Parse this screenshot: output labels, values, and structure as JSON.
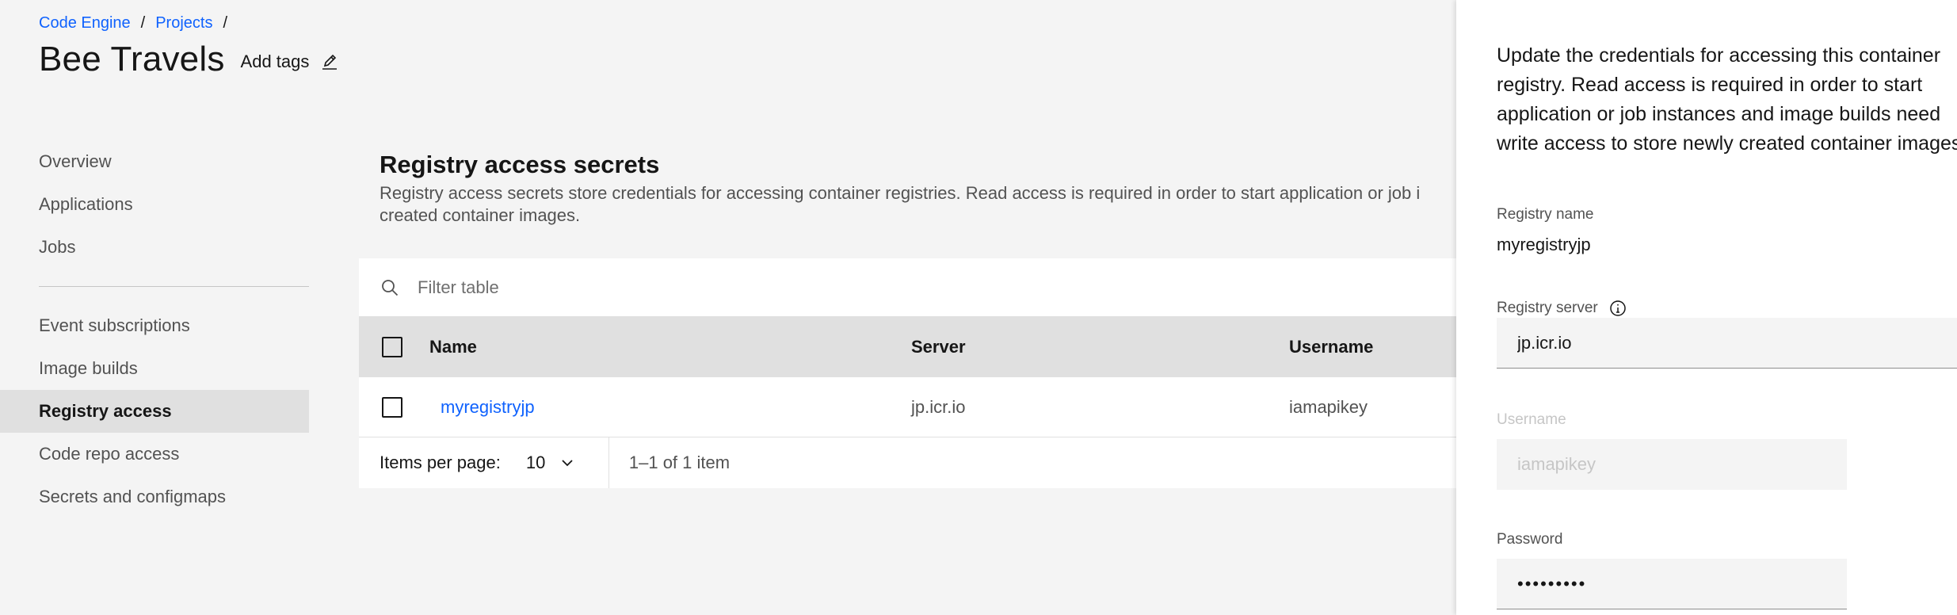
{
  "breadcrumb": {
    "items": [
      "Code Engine",
      "Projects"
    ],
    "separator": "/"
  },
  "header": {
    "title": "Bee Travels",
    "add_tags": "Add tags"
  },
  "sidebar": {
    "group1": [
      "Overview",
      "Applications",
      "Jobs"
    ],
    "group2": [
      "Event subscriptions",
      "Image builds",
      "Registry access",
      "Code repo access",
      "Secrets and configmaps"
    ],
    "active": "Registry access"
  },
  "main": {
    "section_title": "Registry access secrets",
    "section_desc_line1": "Registry access secrets store credentials for accessing container registries. Read access is required in order to start application or job i",
    "section_desc_line2": "created container images.",
    "filter_placeholder": "Filter table",
    "table": {
      "columns": [
        "Name",
        "Server",
        "Username"
      ],
      "rows": [
        {
          "name": "myregistryjp",
          "server": "jp.icr.io",
          "username": "iamapikey"
        }
      ]
    },
    "pagination": {
      "items_per_page_label": "Items per page:",
      "items_per_page_value": "10",
      "range": "1–1 of 1 item"
    }
  },
  "panel": {
    "desc_lines": [
      "Update the credentials for accessing this container",
      "registry. Read access is required in order to start",
      "application or job instances and image builds need",
      "write access to store newly created container images."
    ],
    "registry_name_label": "Registry name",
    "registry_name_value": "myregistryjp",
    "registry_server_label": "Registry server",
    "registry_server_value": "jp.icr.io",
    "username_label": "Username",
    "username_value": "iamapikey",
    "password_label": "Password",
    "password_value": "•••••••••"
  },
  "colors": {
    "link": "#0f62fe",
    "background": "#f4f4f4",
    "nav_active": "#e0e0e0",
    "table_header": "#e0e0e0"
  }
}
